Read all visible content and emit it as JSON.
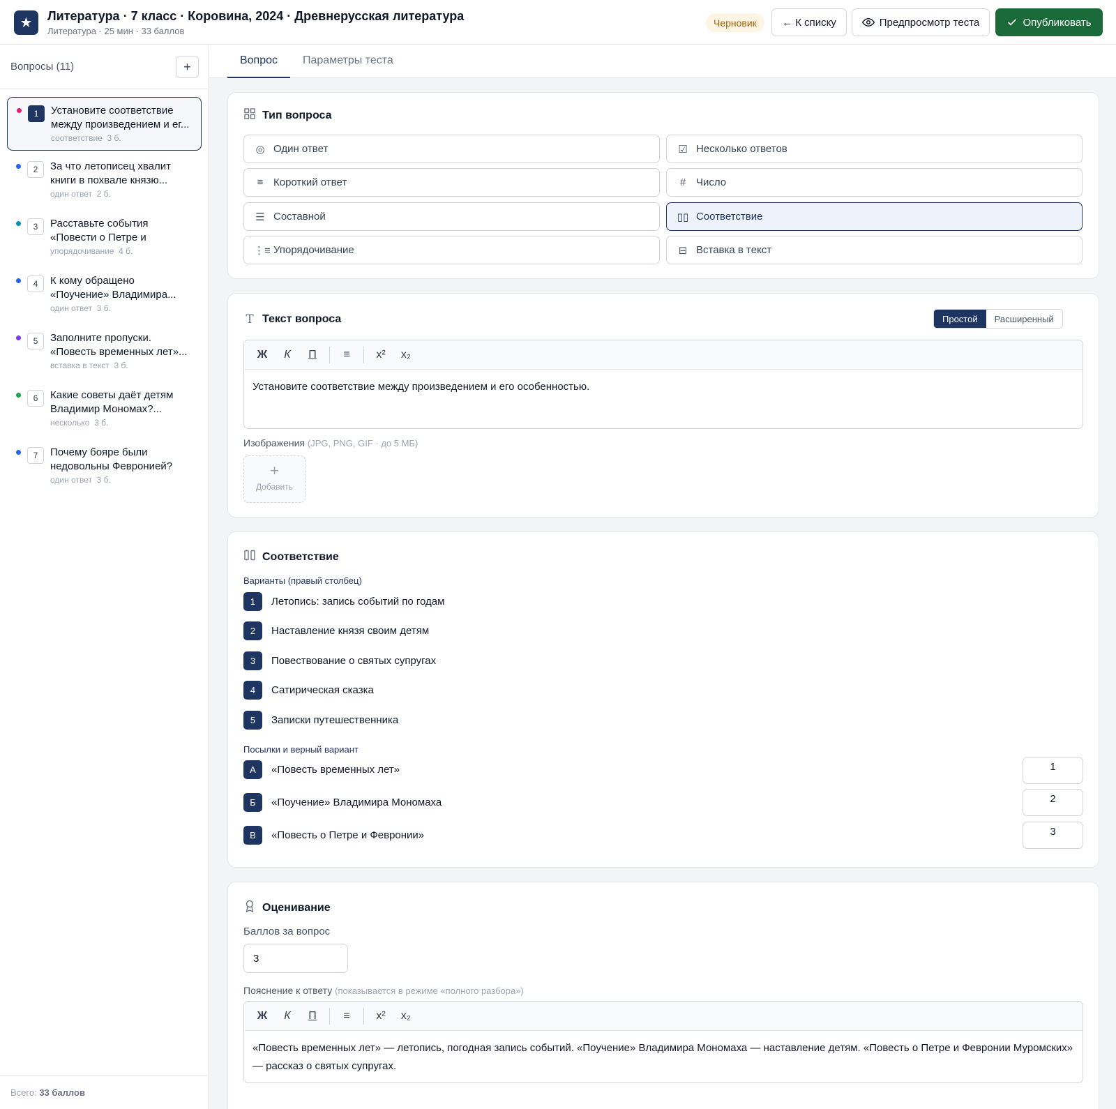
{
  "header": {
    "logo_glyph": "★",
    "title": "Литература · 7 класс · Коровина, 2024 · Древнерусская литература",
    "subtitle": "Литература · 25 мин · 33 баллов",
    "status": "Черновик",
    "back_label": "← К списку",
    "preview_label": "Предпросмотр теста",
    "publish_label": "Опубликовать"
  },
  "sidebar": {
    "title": "Вопросы (11)",
    "add_glyph": "+",
    "total_prefix": "Всего:",
    "total_value": "33 баллов",
    "questions": [
      {
        "num": "1",
        "text": "Установите соответствие между произведением и ег...",
        "type": "соответствие",
        "points": "3 б.",
        "dot": "#e11d74"
      },
      {
        "num": "2",
        "text": "За что летописец хвалит книги в похвале князю...",
        "type": "один ответ",
        "points": "2 б.",
        "dot": "#2563eb"
      },
      {
        "num": "3",
        "text": "Расставьте события «Повести о Петре и Февронии...",
        "type": "упорядочивание",
        "points": "4 б.",
        "dot": "#0891b2"
      },
      {
        "num": "4",
        "text": "К кому обращено «Поучение» Владимира...",
        "type": "один ответ",
        "points": "3 б.",
        "dot": "#2563eb"
      },
      {
        "num": "5",
        "text": "Заполните пропуски. «Повесть временных лет»...",
        "type": "вставка в текст",
        "points": "3 б.",
        "dot": "#7c3aed"
      },
      {
        "num": "6",
        "text": "Какие советы даёт детям Владимир Мономах?...",
        "type": "несколько",
        "points": "3 б.",
        "dot": "#16a34a"
      },
      {
        "num": "7",
        "text": "Почему бояре были недовольны Февронией?",
        "type": "один ответ",
        "points": "3 б.",
        "dot": "#2563eb"
      }
    ]
  },
  "tabs": [
    "Вопрос",
    "Параметры теста"
  ],
  "question_type": {
    "title": "Тип вопроса",
    "options": [
      {
        "label": "Один ответ",
        "icon": "radio-icon",
        "glyph": "◎"
      },
      {
        "label": "Несколько ответов",
        "icon": "checkbox-icon",
        "glyph": "☑"
      },
      {
        "label": "Короткий ответ",
        "icon": "text-lines-icon",
        "glyph": "≡"
      },
      {
        "label": "Число",
        "icon": "hash-icon",
        "glyph": "#"
      },
      {
        "label": "Составной",
        "icon": "list-icon",
        "glyph": "☰"
      },
      {
        "label": "Соответствие",
        "icon": "columns-icon",
        "glyph": "▯▯"
      },
      {
        "label": "Упорядочивание",
        "icon": "ordered-list-icon",
        "glyph": "⋮≡"
      },
      {
        "label": "Вставка в текст",
        "icon": "insert-text-icon",
        "glyph": "⊟"
      }
    ],
    "selected": "Соответствие"
  },
  "question_text": {
    "title": "Текст вопроса",
    "mode_simple": "Простой",
    "mode_advanced": "Расширенный",
    "toolbar": {
      "bold": "Ж",
      "italic": "К",
      "underline": "П",
      "list": "≡",
      "sup": "x²",
      "sub": "x₂"
    },
    "body": "Установите соответствие между произведением и его особенностью.",
    "images_label": "Изображения",
    "images_hint": "(JPG, PNG, GIF · до 5 МБ)",
    "add_image_glyph": "+",
    "add_image_label": "Добавить"
  },
  "matching": {
    "title": "Соответствие",
    "options_label": "Варианты (правый столбец)",
    "options": [
      {
        "key": "1",
        "text": "Летопись: запись событий по годам"
      },
      {
        "key": "2",
        "text": "Наставление князя своим детям"
      },
      {
        "key": "3",
        "text": "Повествование о святых супругах"
      },
      {
        "key": "4",
        "text": "Сатирическая сказка"
      },
      {
        "key": "5",
        "text": "Записки путешественника"
      }
    ],
    "premises_label": "Посылки и верный вариант",
    "premises": [
      {
        "key": "А",
        "text": "«Повесть временных лет»",
        "answer": "1"
      },
      {
        "key": "Б",
        "text": "«Поучение» Владимира Мономаха",
        "answer": "2"
      },
      {
        "key": "В",
        "text": "«Повесть о Петре и Февронии»",
        "answer": "3"
      }
    ]
  },
  "grading": {
    "title": "Оценивание",
    "points_label": "Баллов за вопрос",
    "points_value": "3",
    "explanation_label": "Пояснение к ответу",
    "explanation_hint": "(показывается в режиме «полного разбора»)",
    "explanation": "«Повесть временных лет» — летопись, погодная запись событий. «Поучение» Владимира Мономаха — наставление детям. «Повесть о Петре и Февронии Муромских» — рассказ о святых супругах."
  }
}
